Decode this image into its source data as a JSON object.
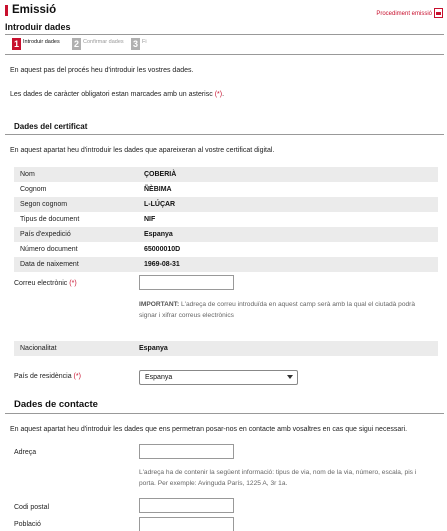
{
  "header": {
    "title": "Emissió",
    "procedure_link": "Procediment emissió",
    "subtitle": "Introduir dades"
  },
  "steps": [
    {
      "number": "1",
      "label": "Introduir dades",
      "state": "active"
    },
    {
      "number": "2",
      "label": "Confirmar dades",
      "state": "inactive"
    },
    {
      "number": "3",
      "label": "Fi",
      "state": "inactive"
    }
  ],
  "intro": {
    "line1": "En aquest pas del procés heu d'introduir les vostres dades.",
    "line2_text": "Les dades de caràcter obligatori estan marcades amb un asterisc",
    "line2_mark": "(*)",
    "line2_end": "."
  },
  "certificate_section": {
    "title": "Dades del certificat",
    "description": "En aquest apartat heu d'introduir les dades que apareixeran al vostre certificat digital.",
    "rows": [
      {
        "label": "Nom",
        "value": "ÇOBERIÀ"
      },
      {
        "label": "Cognom",
        "value": "ÑÈBIMA"
      },
      {
        "label": "Segon cognom",
        "value": "L-LÚÇAR"
      },
      {
        "label": "Tipus de document",
        "value": "NIF"
      },
      {
        "label": "País d'expedició",
        "value": "Espanya"
      },
      {
        "label": "Número document",
        "value": "65000010D"
      },
      {
        "label": "Data de naixement",
        "value": "1969-08-31"
      }
    ],
    "email": {
      "label": "Correu electrònic",
      "required_mark": "(*)",
      "value": "",
      "help_bold": "IMPORTANT:",
      "help_text": "L'adreça de correu introduïda en aquest camp serà amb la qual el ciutadà podrà signar i xifrar correus electrònics"
    },
    "nationality": {
      "label": "Nacionalitat",
      "value": "Espanya"
    },
    "residence": {
      "label": "País de residència",
      "required_mark": "(*)",
      "selected": "Espanya"
    }
  },
  "contact_section": {
    "title": "Dades de contacte",
    "description": "En aquest apartat heu d'introduir les dades que ens permetran posar-nos en contacte amb vosaltres en cas que sigui necessari.",
    "address": {
      "label": "Adreça",
      "value": "",
      "help": "L'adreça ha de contenir la següent informació: tipus de via, nom de la via, número, escala, pis i porta. Per exemple: Avinguda París, 1225 A, 3r 1a."
    },
    "postal_code": {
      "label": "Codi postal",
      "value": ""
    },
    "town": {
      "label": "Població",
      "value": ""
    }
  },
  "colors": {
    "accent": "#c8102e",
    "row_gray": "#ebebeb",
    "inactive_step": "#b0b0b0"
  }
}
